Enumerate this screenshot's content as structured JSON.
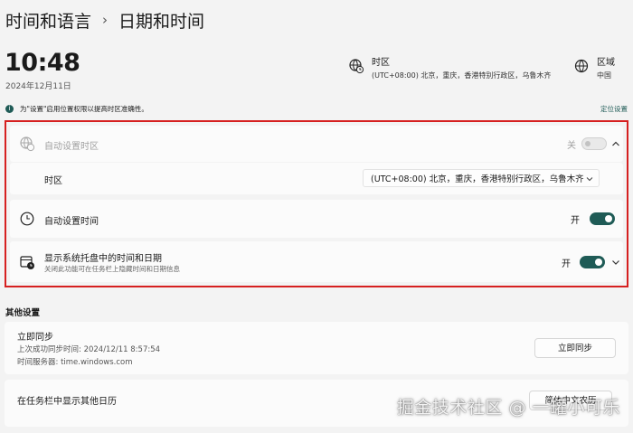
{
  "breadcrumb": {
    "parent": "时间和语言",
    "separator": "›",
    "current": "日期和时间"
  },
  "clock": {
    "time": "10:48",
    "date": "2024年12月11日"
  },
  "timezone_info": {
    "label": "时区",
    "value": "(UTC+08:00) 北京，重庆，香港特别行政区，乌鲁木齐"
  },
  "region_info": {
    "label": "区域",
    "value": "中国"
  },
  "notice": {
    "icon_text": "i",
    "text": "为\"设置\"启用位置权限以提高时区准确性。",
    "link": "定位设置"
  },
  "settings": {
    "auto_timezone": {
      "title": "自动设置时区",
      "state": "关",
      "enabled": false,
      "disabled": true
    },
    "timezone": {
      "title": "时区",
      "value": "(UTC+08:00) 北京，重庆，香港特别行政区，乌鲁木齐"
    },
    "auto_time": {
      "title": "自动设置时间",
      "state": "开",
      "enabled": true
    },
    "tray": {
      "title": "显示系统托盘中的时间和日期",
      "subtitle": "关闭此功能可在任务栏上隐藏时间和日期信息",
      "state": "开",
      "enabled": true
    }
  },
  "other": {
    "heading": "其他设置",
    "sync": {
      "title": "立即同步",
      "last_sync": "上次成功同步时间: 2024/12/11 8:57:54",
      "server": "时间服务器: time.windows.com",
      "button": "立即同步"
    },
    "calendar": {
      "title": "在任务栏中显示其他日历",
      "select_value": "简体中文农历"
    }
  },
  "watermark": "掘金技术社区 @ 一罐小可乐",
  "colors": {
    "accent": "#1f5b56",
    "highlight_border": "#d62020"
  }
}
